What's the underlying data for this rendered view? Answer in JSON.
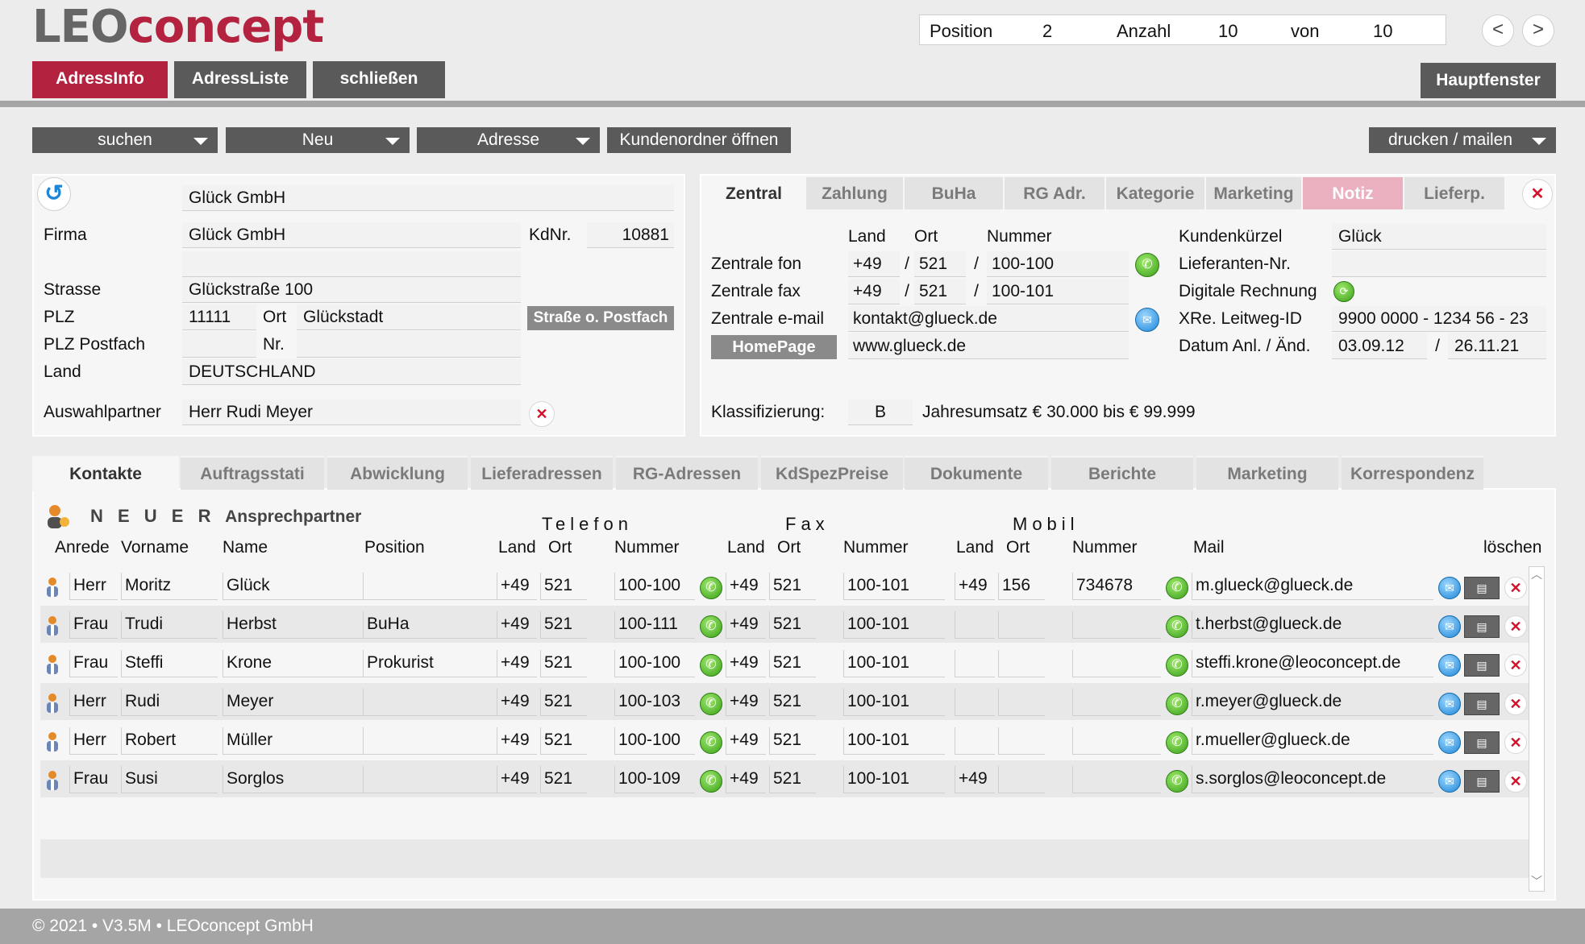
{
  "app": {
    "logo_part1": "LEO",
    "logo_part2": "concept"
  },
  "position": {
    "position_label": "Position",
    "position_value": "2",
    "count_label": "Anzahl",
    "count_value": "10",
    "of_label": "von",
    "of_value": "10",
    "prev": "<",
    "next": ">"
  },
  "topnav": {
    "adressinfo": "AdressInfo",
    "adressliste": "AdressListe",
    "schliessen": "schließen",
    "hauptfenster": "Hauptfenster"
  },
  "toolbar": {
    "suchen": "suchen",
    "neu": "Neu",
    "adresse": "Adresse",
    "kundenordner": "Kundenordner öffnen",
    "drucken": "drucken / mailen"
  },
  "address": {
    "name_line": "Glück GmbH",
    "firma_label": "Firma",
    "firma": "Glück GmbH",
    "kdnr_label": "KdNr.",
    "kdnr": "10881",
    "strasse_label": "Strasse",
    "strasse": "Glückstraße 100",
    "plz_label": "PLZ",
    "plz": "11111",
    "ort_label": "Ort",
    "ort": "Glückstadt",
    "strasse_postfach_button": "Straße o. Postfach",
    "plz_postfach_label": "PLZ Postfach",
    "nr_label": "Nr.",
    "land_label": "Land",
    "land": "DEUTSCHLAND",
    "auswahlpartner_label": "Auswahlpartner",
    "auswahlpartner": "Herr Rudi Meyer"
  },
  "detail_tabs": [
    "Zentral",
    "Zahlung",
    "BuHa",
    "RG Adr.",
    "Kategorie",
    "Marketing",
    "Notiz",
    "Lieferp."
  ],
  "zentral": {
    "col_land": "Land",
    "col_ort": "Ort",
    "col_nummer": "Nummer",
    "fon_label": "Zentrale fon",
    "fon_land": "+49",
    "fon_ort": "521",
    "fon_nummer": "100-100",
    "fax_label": "Zentrale fax",
    "fax_land": "+49",
    "fax_ort": "521",
    "fax_nummer": "100-101",
    "email_label": "Zentrale e-mail",
    "email": "kontakt@glueck.de",
    "homepage_button": "HomePage",
    "homepage": "www.glueck.de",
    "sep": "/",
    "kuerzel_label": "Kundenkürzel",
    "kuerzel": "Glück",
    "lieferanten_label": "Lieferanten-Nr.",
    "digitale_label": "Digitale Rechnung",
    "leitweg_label": "XRe. Leitweg-ID",
    "leitweg": "9900 0000 - 1234 56 - 23",
    "datum_label": "Datum Anl. / Änd.",
    "datum_anl": "03.09.12",
    "datum_aend": "26.11.21",
    "klass_label": "Klassifizierung:",
    "klass": "B",
    "umsatz": "Jahresumsatz € 30.000 bis € 99.999"
  },
  "bottom_tabs": [
    "Kontakte",
    "Auftragsstati",
    "Abwicklung",
    "Lieferadressen",
    "RG-Adressen",
    "KdSpezPreise",
    "Dokumente",
    "Berichte",
    "Marketing",
    "Korrespondenz"
  ],
  "contacts": {
    "new_label_spaced": "N E U E R",
    "new_label": "Ansprechpartner",
    "group_telefon": "Telefon",
    "group_fax": "Fax",
    "group_mobil": "Mobil",
    "headers": {
      "anrede": "Anrede",
      "vorname": "Vorname",
      "name": "Name",
      "position": "Position",
      "land": "Land",
      "ort": "Ort",
      "nummer": "Nummer",
      "mail": "Mail",
      "loeschen": "löschen"
    },
    "rows": [
      {
        "anrede": "Herr",
        "vorname": "Moritz",
        "name": "Glück",
        "position": "",
        "tel_land": "+49",
        "tel_ort": "521",
        "tel_nr": "100-100",
        "fax_land": "+49",
        "fax_ort": "521",
        "fax_nr": "100-101",
        "mob_land": "+49",
        "mob_ort": "156",
        "mob_nr": "734678",
        "mail": "m.glueck@glueck.de"
      },
      {
        "anrede": "Frau",
        "vorname": "Trudi",
        "name": "Herbst",
        "position": "BuHa",
        "tel_land": "+49",
        "tel_ort": "521",
        "tel_nr": "100-111",
        "fax_land": "+49",
        "fax_ort": "521",
        "fax_nr": "100-101",
        "mob_land": "",
        "mob_ort": "",
        "mob_nr": "",
        "mail": "t.herbst@glueck.de"
      },
      {
        "anrede": "Frau",
        "vorname": "Steffi",
        "name": "Krone",
        "position": "Prokurist",
        "tel_land": "+49",
        "tel_ort": "521",
        "tel_nr": "100-100",
        "fax_land": "+49",
        "fax_ort": "521",
        "fax_nr": "100-101",
        "mob_land": "",
        "mob_ort": "",
        "mob_nr": "",
        "mail": "steffi.krone@leoconcept.de"
      },
      {
        "anrede": "Herr",
        "vorname": "Rudi",
        "name": "Meyer",
        "position": "",
        "tel_land": "+49",
        "tel_ort": "521",
        "tel_nr": "100-103",
        "fax_land": "+49",
        "fax_ort": "521",
        "fax_nr": "100-101",
        "mob_land": "",
        "mob_ort": "",
        "mob_nr": "",
        "mail": "r.meyer@glueck.de"
      },
      {
        "anrede": "Herr",
        "vorname": "Robert",
        "name": "Müller",
        "position": "",
        "tel_land": "+49",
        "tel_ort": "521",
        "tel_nr": "100-100",
        "fax_land": "+49",
        "fax_ort": "521",
        "fax_nr": "100-101",
        "mob_land": "",
        "mob_ort": "",
        "mob_nr": "",
        "mail": "r.mueller@glueck.de"
      },
      {
        "anrede": "Frau",
        "vorname": "Susi",
        "name": "Sorglos",
        "position": "",
        "tel_land": "+49",
        "tel_ort": "521",
        "tel_nr": "100-109",
        "fax_land": "+49",
        "fax_ort": "521",
        "fax_nr": "100-101",
        "mob_land": "+49",
        "mob_ort": "",
        "mob_nr": "",
        "mail": "s.sorglos@leoconcept.de"
      }
    ]
  },
  "footer": {
    "text": "© 2021 • V3.5M • LEOconcept GmbH"
  },
  "colors": {
    "brand_red": "#b3233f",
    "button_gray": "#5a5a5a",
    "notiz_pink": "#eab0c0"
  },
  "icons": {
    "back": "refresh-back-icon",
    "phone": "phone-icon",
    "mail": "mail-icon",
    "delete": "delete-x-icon",
    "card": "contact-card-icon",
    "person": "person-icon"
  }
}
